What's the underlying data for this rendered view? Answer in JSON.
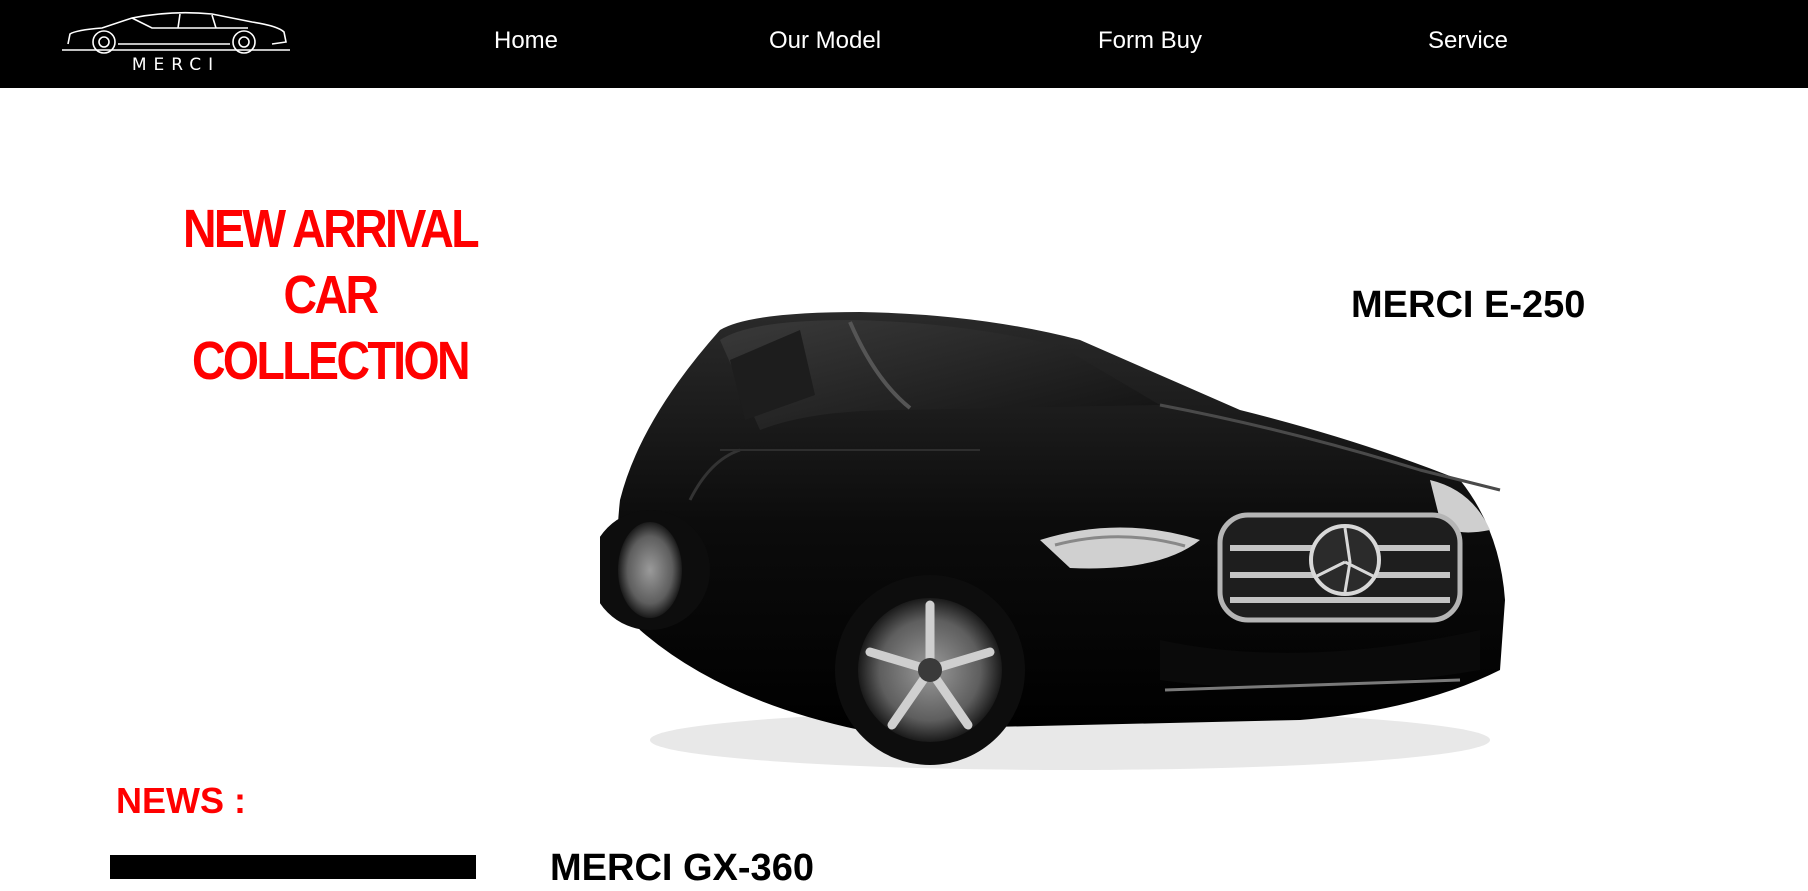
{
  "brand": {
    "logo_text": "MERCI"
  },
  "nav": {
    "home": "Home",
    "our_model": "Our Model",
    "form_buy": "Form Buy",
    "service": "Service"
  },
  "hero": {
    "title_line1": "NEW ARRIVAL CAR",
    "title_line2": "COLLECTION",
    "featured_car": "MERCI E-250"
  },
  "news": {
    "title": "NEWS :",
    "car_name": "MERCI GX-360"
  },
  "colors": {
    "nav_bg": "#000000",
    "accent": "#ff0000",
    "text": "#000000"
  }
}
